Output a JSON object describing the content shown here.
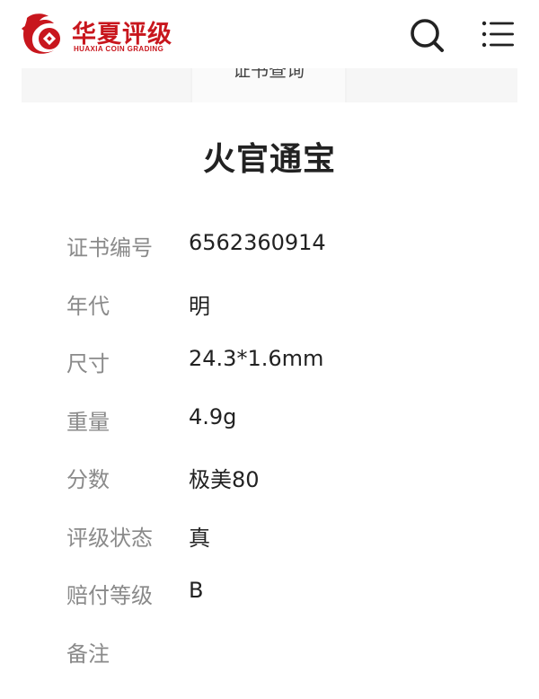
{
  "header": {
    "logo_cn": "华夏评级",
    "logo_en": "HUAXIA COIN GRADING",
    "brand_color": "#c8161d",
    "search_icon": "search-icon",
    "menu_icon": "hamburger-menu-icon"
  },
  "tabs": [
    {
      "label": ""
    },
    {
      "label": "证书查询"
    },
    {
      "label": ""
    }
  ],
  "item": {
    "title": "火官通宝"
  },
  "details": [
    {
      "label": "证书编号",
      "value": "6562360914"
    },
    {
      "label": "年代",
      "value": "明"
    },
    {
      "label": "尺寸",
      "value": "24.3*1.6mm"
    },
    {
      "label": "重量",
      "value": "4.9g"
    },
    {
      "label": "分数",
      "value": "极美80"
    },
    {
      "label": "评级状态",
      "value": "真"
    },
    {
      "label": "赔付等级",
      "value": "B"
    },
    {
      "label": "备注",
      "value": ""
    }
  ]
}
